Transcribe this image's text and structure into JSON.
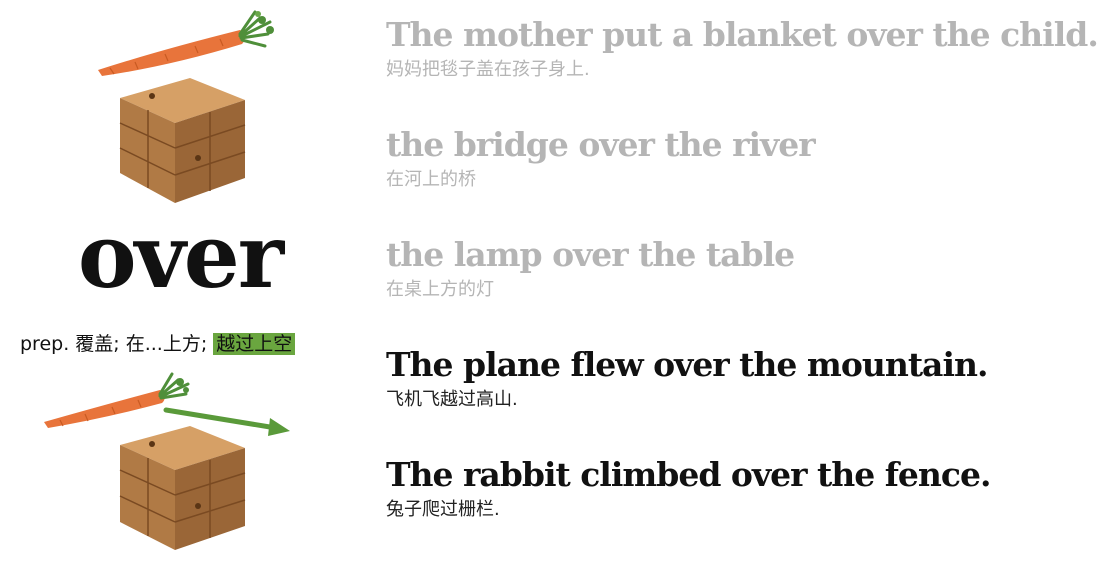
{
  "word": "over",
  "definition": {
    "prefix": "prep. 覆盖; 在...上方; ",
    "highlight": "越过上空"
  },
  "examples": [
    {
      "en": "The mother put a blanket over the child.",
      "zh": "妈妈把毯子盖在孩子身上.",
      "state": "faded"
    },
    {
      "en": "the bridge over the river",
      "zh": "在河上的桥",
      "state": "faded"
    },
    {
      "en": "the lamp over the table",
      "zh": "在桌上方的灯",
      "state": "faded"
    },
    {
      "en": "The plane flew over the mountain.",
      "zh": "飞机飞越过高山.",
      "state": "active"
    },
    {
      "en": "The rabbit climbed over the fence.",
      "zh": "兔子爬过栅栏.",
      "state": "active"
    }
  ],
  "colors": {
    "highlight": "#6aa63f",
    "arrow": "#5a9a3a",
    "carrot": "#e8743b",
    "carrot_leaves": "#4f8f3a",
    "wood_top": "#d6a066",
    "wood_left": "#b07a45",
    "wood_right": "#9a6637",
    "faded_text": "#b5b5b5"
  },
  "icons": [
    "carrot-icon",
    "wooden-cube-icon",
    "right-arrow-icon"
  ]
}
